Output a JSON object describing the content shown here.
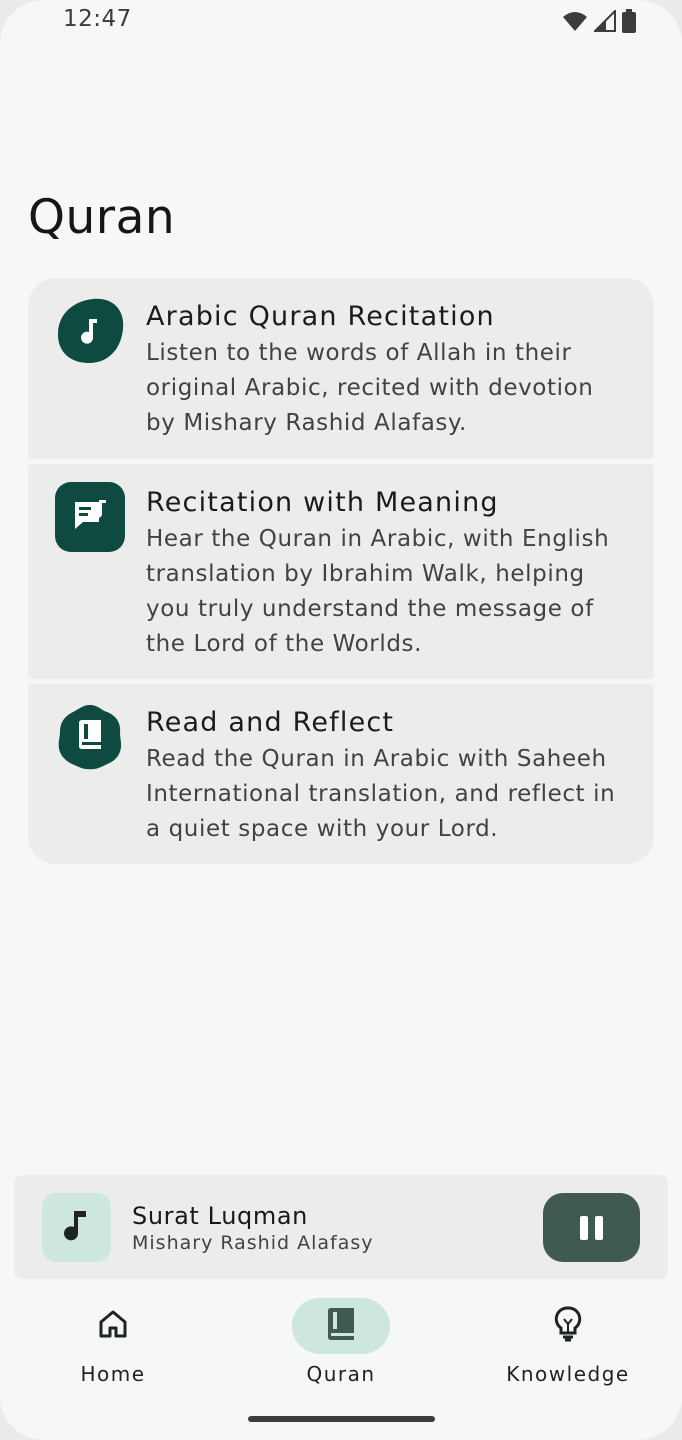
{
  "status_bar": {
    "time": "12:47",
    "icons": [
      "wifi-icon",
      "signal-icon",
      "battery-icon"
    ]
  },
  "page": {
    "title": "Quran"
  },
  "cards": [
    {
      "title": "Arabic Quran Recitation",
      "description": "Listen to the words of Allah in their original Arabic, recited with devotion by Mishary Rashid Alafasy.",
      "icon": "music-note-icon"
    },
    {
      "title": "Recitation with Meaning",
      "description": "Hear the Quran in Arabic, with English translation by Ibrahim Walk, helping you truly understand the message of the Lord of the Worlds.",
      "icon": "lyrics-icon"
    },
    {
      "title": "Read and Reflect",
      "description": "Read the Quran in Arabic with Saheeh International translation, and reflect in a quiet space with your Lord.",
      "icon": "book-icon"
    }
  ],
  "player": {
    "title": "Surat Luqman",
    "artist": "Mishary Rashid Alafasy",
    "art_icon": "music-note-icon",
    "control_icon": "pause-icon"
  },
  "nav": {
    "items": [
      {
        "label": "Home",
        "icon": "home-icon",
        "active": false
      },
      {
        "label": "Quran",
        "icon": "book-icon",
        "active": true
      },
      {
        "label": "Knowledge",
        "icon": "lightbulb-icon",
        "active": false
      }
    ]
  },
  "colors": {
    "accent_dark": "#0f4a40",
    "accent_light": "#cde6e0",
    "player_button": "#3f5a52",
    "surface": "#f6f8f5",
    "card": "#ecedeb"
  }
}
